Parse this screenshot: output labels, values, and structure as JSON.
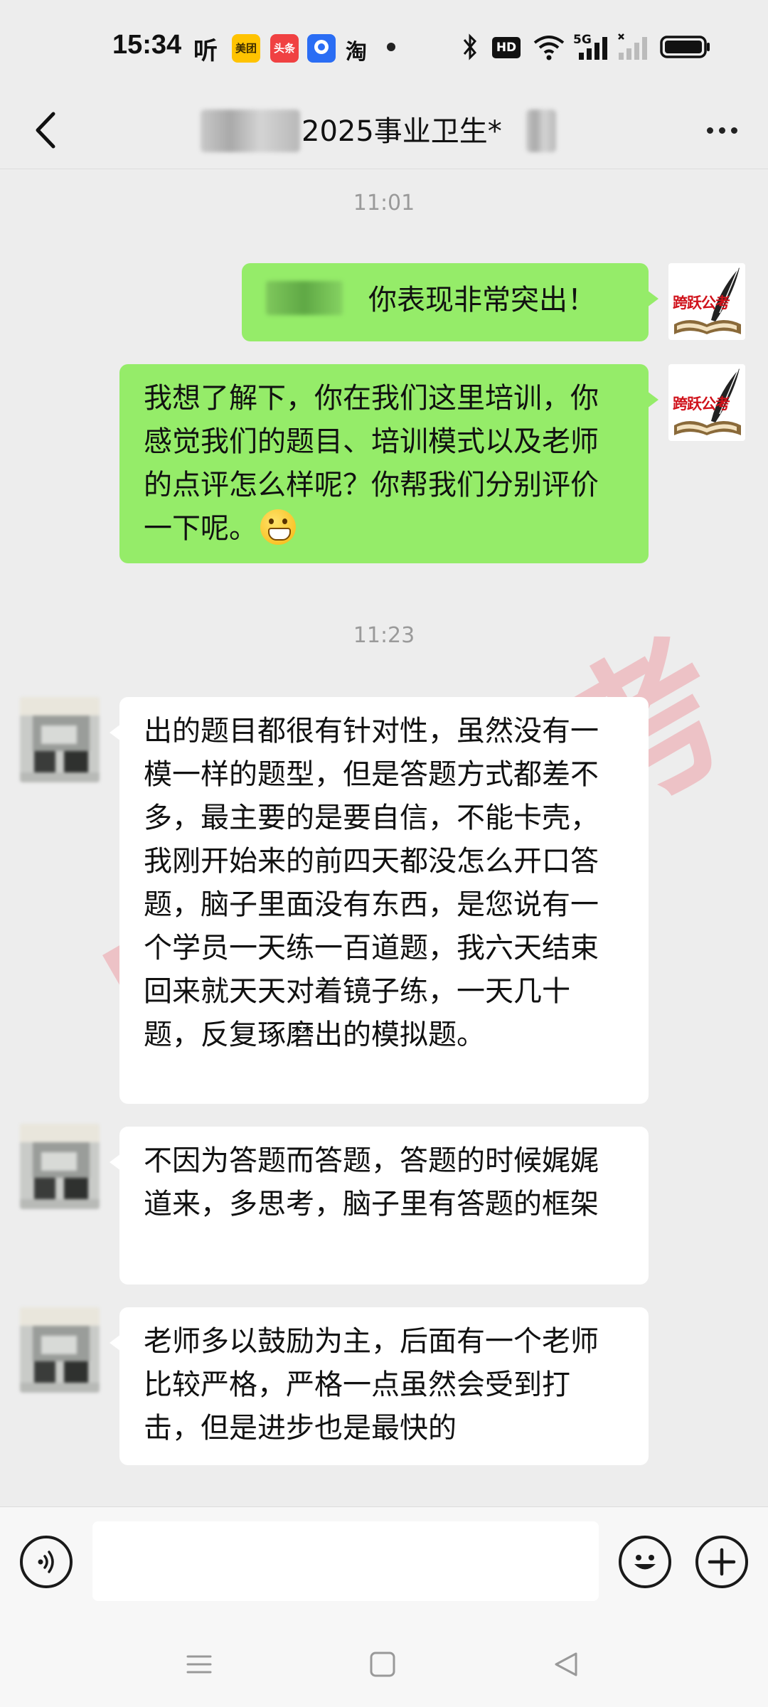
{
  "status_bar": {
    "time": "15:34",
    "listen_glyph": "听",
    "app_icons": [
      {
        "name": "meituan",
        "label": "美团",
        "color": "#ffc300"
      },
      {
        "name": "toutiao",
        "label": "头条",
        "color": "#f04142"
      },
      {
        "name": "app-blue",
        "label": "",
        "color": "#2a6df4"
      }
    ],
    "taobao_glyph": "淘",
    "network_label": "5G",
    "hd_label": "HD"
  },
  "title_bar": {
    "title": "2025事业卫生*",
    "back_icon": "chevron-left-icon",
    "more_icon": "more-dots-icon"
  },
  "messages": {
    "time_1": "11:01",
    "sent_1": "你表现非常突出！",
    "sent_2": "我想了解下，你在我们这里培训，你感觉我们的题目、培训模式以及老师的点评怎么样呢？你帮我们分别评价一下呢。",
    "time_2": "11:23",
    "recv_1": "出的题目都很有针对性，虽然没有一模一样的题型，但是答题方式都差不多，最主要的是要自信，不能卡壳，我刚开始来的前四天都没怎么开口答题，脑子里面没有东西，是您说有一个学员一天练一百道题，我六天结束回来就天天对着镜子练，一天几十题，反复琢磨出的模拟题。",
    "recv_2": "不因为答题而答题，答题的时候娓娓道来，多思考，脑子里有答题的框架",
    "recv_3": "老师多以鼓励为主，后面有一个老师比较严格，严格一点虽然会受到打击，但是进步也是最快的"
  },
  "brand_avatar": {
    "text": "跨跃公考",
    "color": "#d0121b"
  },
  "watermark": {
    "text": "跨跃公考"
  },
  "input_bar": {
    "voice_icon": "voice-icon",
    "emoji_icon": "emoji-icon",
    "plus_icon": "plus-icon",
    "input_value": ""
  },
  "colors": {
    "sent_bubble": "#95ec69",
    "received_bubble": "#ffffff",
    "background": "#ededed"
  }
}
